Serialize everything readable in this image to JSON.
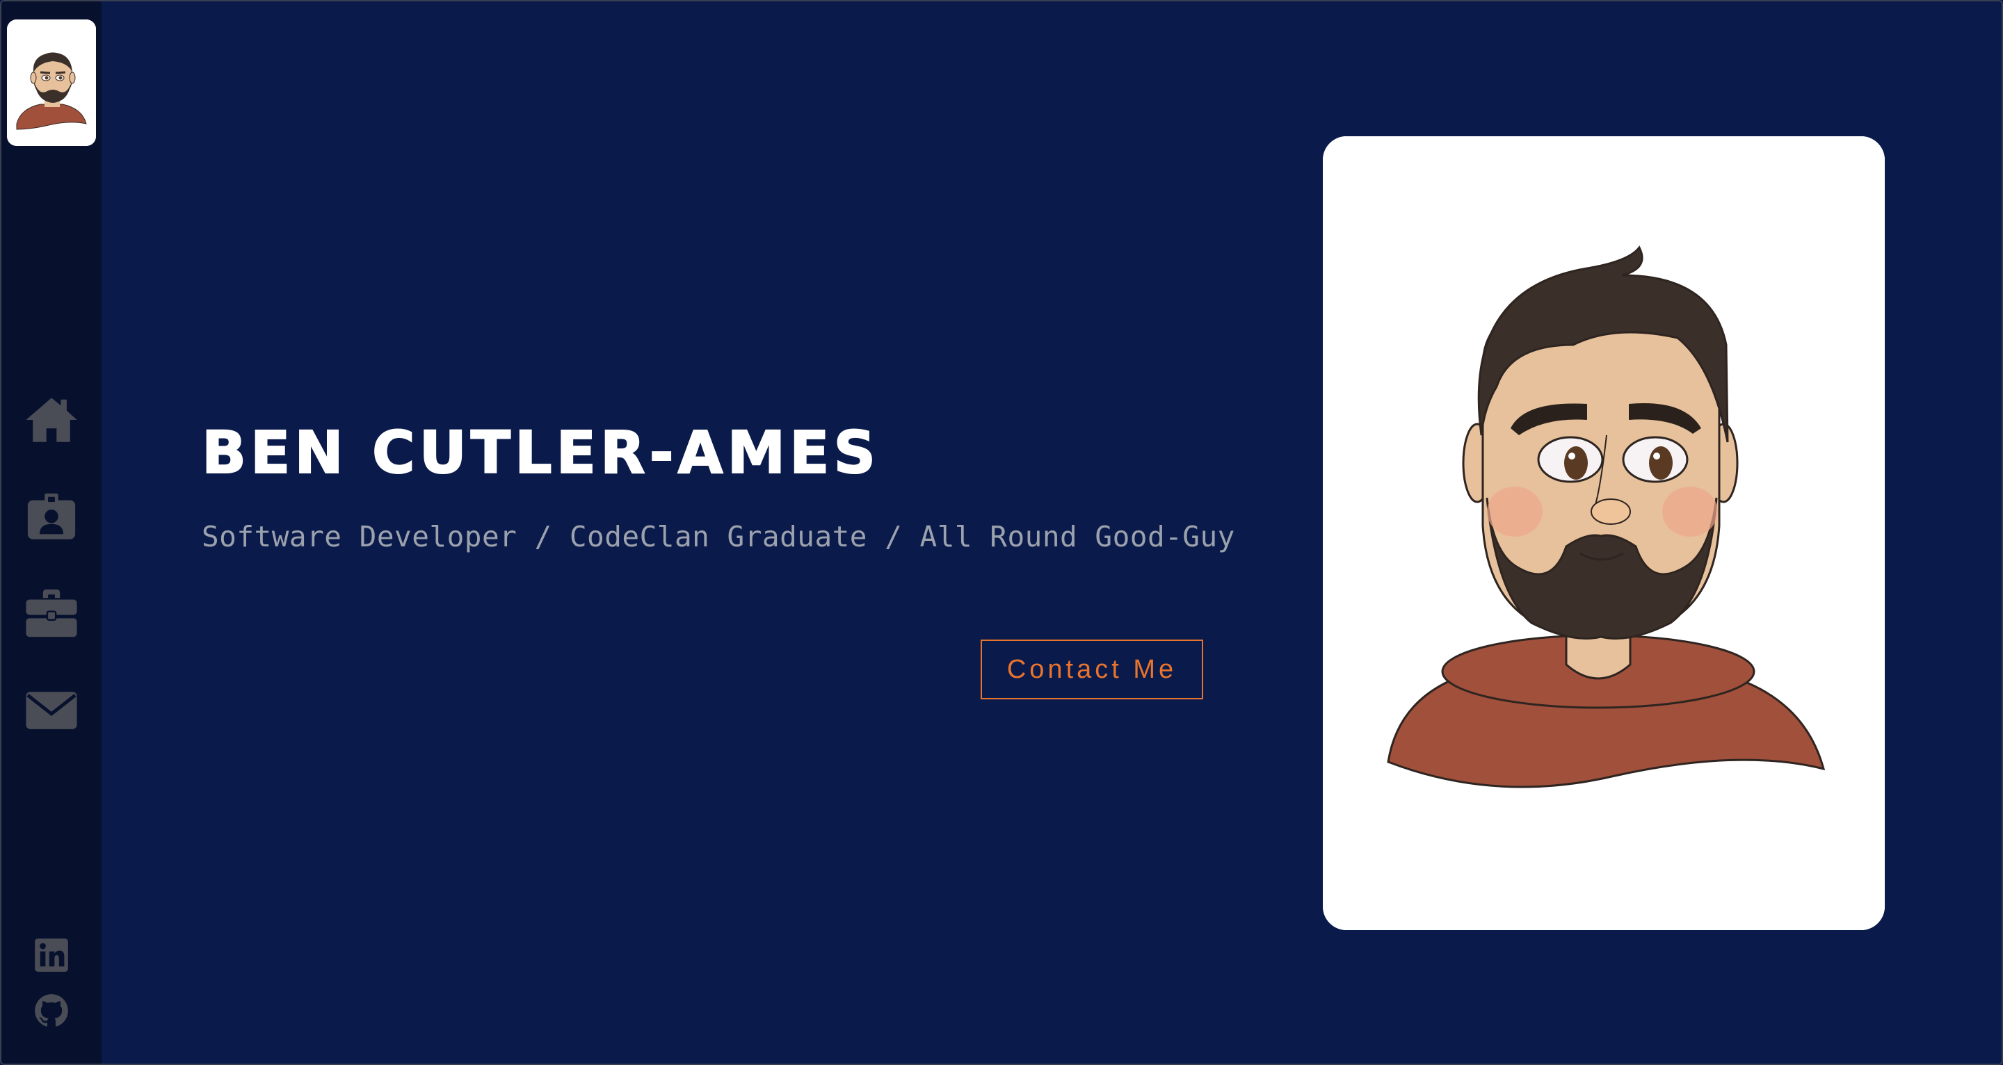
{
  "sidebar": {
    "logo_icon": "avatar-portrait",
    "nav": [
      {
        "id": "home",
        "icon": "home-icon"
      },
      {
        "id": "about",
        "icon": "id-badge-icon"
      },
      {
        "id": "projects",
        "icon": "briefcase-icon"
      },
      {
        "id": "contact",
        "icon": "envelope-icon"
      }
    ],
    "social": [
      {
        "id": "linkedin",
        "icon": "linkedin-icon"
      },
      {
        "id": "github",
        "icon": "github-icon"
      }
    ]
  },
  "hero": {
    "name": "BEN CUTLER-AMES",
    "tagline": "Software Developer / CodeClan Graduate / All Round Good-Guy",
    "cta_label": "Contact Me"
  },
  "portrait": {
    "icon": "cartoon-portrait"
  },
  "colors": {
    "background": "#0a1a4a",
    "sidebar": "#07112e",
    "accent": "#e8742e",
    "icon_gray": "#4a4d55",
    "tagline": "#9ba1ad"
  }
}
